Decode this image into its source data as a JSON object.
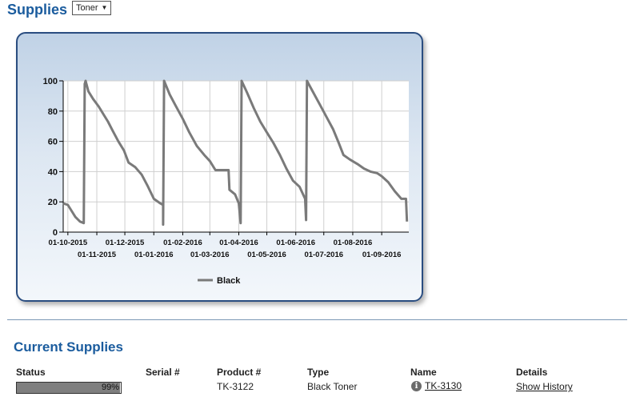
{
  "header": {
    "title": "Supplies",
    "selector_value": "Toner"
  },
  "chart_data": {
    "type": "line",
    "ylim": [
      0,
      100
    ],
    "yticks": [
      0,
      20,
      40,
      60,
      80,
      100
    ],
    "xlim": [
      "2015-09-26",
      "2016-09-30"
    ],
    "xticks": [
      "2015-10-01",
      "2015-11-01",
      "2015-12-01",
      "2016-01-01",
      "2016-02-01",
      "2016-03-01",
      "2016-04-01",
      "2016-05-01",
      "2016-06-01",
      "2016-07-01",
      "2016-08-01",
      "2016-09-01"
    ],
    "xticklabels": [
      "01-10-2015",
      "01-11-2015",
      "01-12-2015",
      "01-01-2016",
      "01-02-2016",
      "01-03-2016",
      "01-04-2016",
      "01-05-2016",
      "01-06-2016",
      "01-07-2016",
      "01-08-2016",
      "01-09-2016"
    ],
    "grid": true,
    "legend_position": "bottom",
    "series": [
      {
        "name": "Black",
        "color": "#7a7a7a",
        "points": [
          [
            "2015-09-26",
            19
          ],
          [
            "2015-10-01",
            18
          ],
          [
            "2015-10-05",
            14
          ],
          [
            "2015-10-09",
            10
          ],
          [
            "2015-10-14",
            7
          ],
          [
            "2015-10-18",
            6
          ],
          [
            "2015-10-19",
            98
          ],
          [
            "2015-10-20",
            100
          ],
          [
            "2015-10-23",
            93
          ],
          [
            "2015-10-28",
            88
          ],
          [
            "2015-11-03",
            83
          ],
          [
            "2015-11-08",
            78
          ],
          [
            "2015-11-13",
            73
          ],
          [
            "2015-11-18",
            67
          ],
          [
            "2015-11-24",
            60
          ],
          [
            "2015-11-30",
            54
          ],
          [
            "2015-12-05",
            46
          ],
          [
            "2015-12-12",
            43
          ],
          [
            "2015-12-19",
            38
          ],
          [
            "2015-12-25",
            31
          ],
          [
            "2016-01-01",
            22
          ],
          [
            "2016-01-08",
            19
          ],
          [
            "2016-01-11",
            18
          ],
          [
            "2016-01-11",
            5
          ],
          [
            "2016-01-12",
            100
          ],
          [
            "2016-01-18",
            91
          ],
          [
            "2016-01-24",
            84
          ],
          [
            "2016-02-01",
            75
          ],
          [
            "2016-02-08",
            66
          ],
          [
            "2016-02-16",
            57
          ],
          [
            "2016-02-24",
            51
          ],
          [
            "2016-03-01",
            47
          ],
          [
            "2016-03-07",
            41
          ],
          [
            "2016-03-16",
            41
          ],
          [
            "2016-03-21",
            41
          ],
          [
            "2016-03-22",
            28
          ],
          [
            "2016-03-28",
            25
          ],
          [
            "2016-04-01",
            19
          ],
          [
            "2016-04-03",
            6
          ],
          [
            "2016-04-04",
            100
          ],
          [
            "2016-04-10",
            92
          ],
          [
            "2016-04-17",
            82
          ],
          [
            "2016-04-24",
            73
          ],
          [
            "2016-05-01",
            66
          ],
          [
            "2016-05-08",
            59
          ],
          [
            "2016-05-15",
            51
          ],
          [
            "2016-05-22",
            42
          ],
          [
            "2016-05-29",
            34
          ],
          [
            "2016-06-05",
            30
          ],
          [
            "2016-06-11",
            22
          ],
          [
            "2016-06-12",
            8
          ],
          [
            "2016-06-13",
            100
          ],
          [
            "2016-06-20",
            92
          ],
          [
            "2016-06-27",
            84
          ],
          [
            "2016-07-04",
            76
          ],
          [
            "2016-07-11",
            68
          ],
          [
            "2016-07-17",
            59
          ],
          [
            "2016-07-22",
            51
          ],
          [
            "2016-07-29",
            48
          ],
          [
            "2016-08-06",
            45
          ],
          [
            "2016-08-13",
            42
          ],
          [
            "2016-08-20",
            40
          ],
          [
            "2016-08-27",
            39
          ],
          [
            "2016-09-01",
            37
          ],
          [
            "2016-09-08",
            33
          ],
          [
            "2016-09-15",
            27
          ],
          [
            "2016-09-22",
            22
          ],
          [
            "2016-09-27",
            22
          ],
          [
            "2016-09-28",
            7
          ]
        ]
      }
    ]
  },
  "current_supplies": {
    "title": "Current Supplies",
    "columns": {
      "status": "Status",
      "serial": "Serial #",
      "product": "Product #",
      "type": "Type",
      "name": "Name",
      "details": "Details"
    },
    "row": {
      "status_percent": 99,
      "status_label": "99%",
      "serial": "",
      "product": "TK-3122",
      "type": "Black Toner",
      "name": "TK-3130",
      "details": "Show History",
      "info_icon": "info-icon"
    }
  }
}
